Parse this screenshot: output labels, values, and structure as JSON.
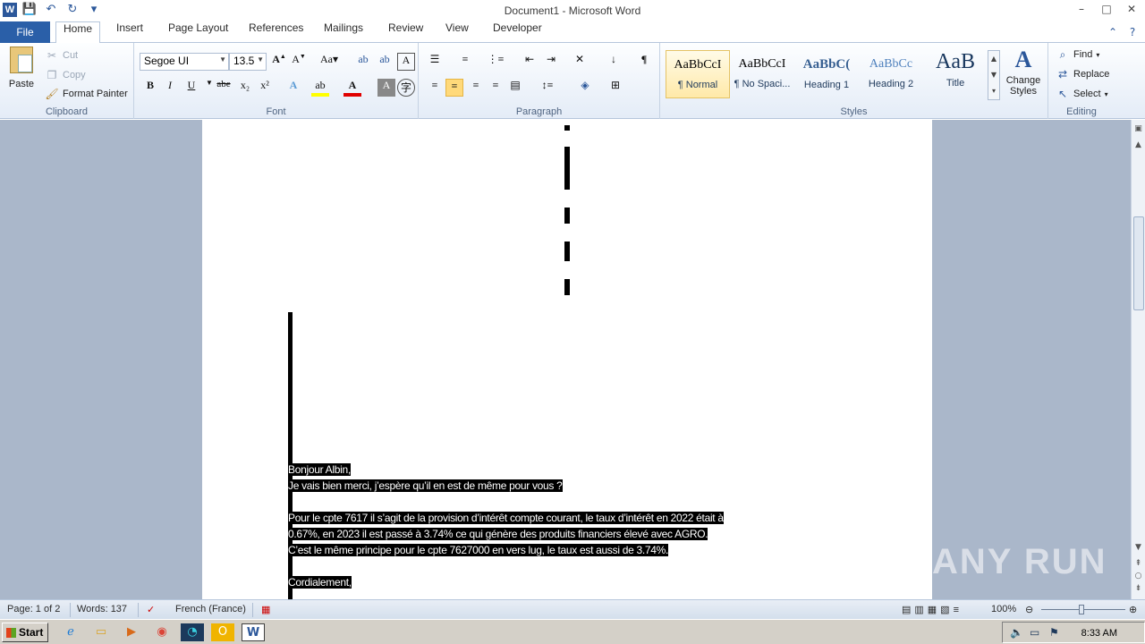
{
  "window": {
    "title": "Document1 - Microsoft Word",
    "app_icon": "W"
  },
  "qat": {
    "icons": [
      "save-icon",
      "undo-icon",
      "redo-icon",
      "customize-icon"
    ]
  },
  "tabs": {
    "file": "File",
    "items": [
      "Home",
      "Insert",
      "Page Layout",
      "References",
      "Mailings",
      "Review",
      "View",
      "Developer"
    ],
    "active": "Home"
  },
  "ribbon": {
    "clipboard": {
      "label": "Clipboard",
      "paste": "Paste",
      "cut": "Cut",
      "copy": "Copy",
      "format_painter": "Format Painter"
    },
    "font": {
      "label": "Font",
      "family": "Segoe UI",
      "size": "13.5",
      "bold": "B",
      "italic": "I",
      "underline": "U",
      "strike": "abe",
      "subscript": "x₂",
      "superscript": "x²"
    },
    "paragraph": {
      "label": "Paragraph"
    },
    "styles": {
      "label": "Styles",
      "items": [
        {
          "sample": "AaBbCcI",
          "name": "¶ Normal"
        },
        {
          "sample": "AaBbCcI",
          "name": "¶ No Spaci..."
        },
        {
          "sample": "AaBbC(",
          "name": "Heading 1"
        },
        {
          "sample": "AaBbCc",
          "name": "Heading 2"
        },
        {
          "sample": "AaB",
          "name": "Title"
        }
      ],
      "change_styles": "Change Styles"
    },
    "editing": {
      "label": "Editing",
      "find": "Find",
      "replace": "Replace",
      "select": "Select"
    }
  },
  "document": {
    "lines": [
      "Bonjour Albin,",
      "Je vais bien merci, j’espère qu’il en est de même pour vous ?",
      "Pour le cpte 7617 il s’agit de la provision d’intérêt compte courant, le taux d’intérêt en 2022 était à",
      "0.67%, en 2023 il est passé à 3.74% ce qui génère des produits financiers élevé avec AGRO.",
      "C’est le même principe pour le cpte 7627000 en vers lug, le taux est aussi de 3.74%.",
      "Cordialement,"
    ]
  },
  "statusbar": {
    "page": "Page: 1 of 2",
    "words": "Words: 137",
    "language": "French (France)",
    "zoom": "100%"
  },
  "taskbar": {
    "start": "Start",
    "clock": "8:33 AM"
  },
  "watermark": "ANY RUN"
}
